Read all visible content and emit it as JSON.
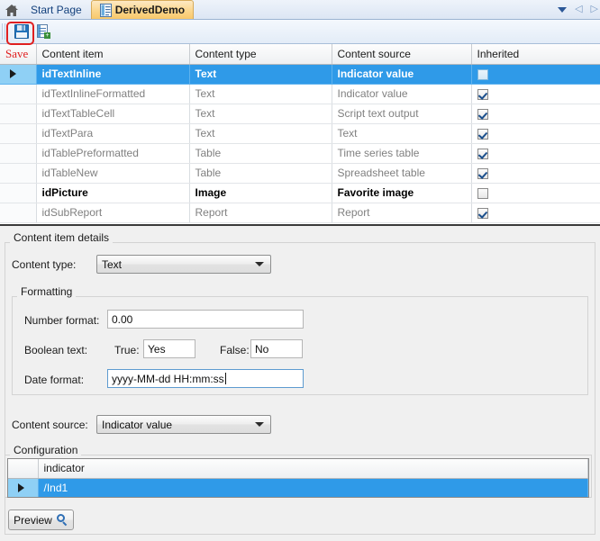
{
  "tabstrip": {
    "home_icon": "home-icon",
    "tabs": [
      {
        "label": "Start Page",
        "active": false,
        "icon": ""
      },
      {
        "label": "DerivedDemo",
        "active": true,
        "icon": "document-icon"
      }
    ],
    "dropdown_icon": "chevron-down-icon",
    "prev_icon": "◁",
    "next_icon": "▷"
  },
  "toolbar": {
    "save_icon": "save-floppy-icon",
    "new_icon": "new-document-icon"
  },
  "annotation": {
    "label": "Save",
    "color": "#e02020"
  },
  "grid": {
    "columns": [
      "",
      "Content item",
      "Content type",
      "Content source",
      "Inherited"
    ],
    "rows": [
      {
        "item": "idTextInline",
        "type": "Text",
        "source": "Indicator value",
        "inherited": false,
        "selected": true,
        "emphasis": "selected"
      },
      {
        "item": "idTextInlineFormatted",
        "type": "Text",
        "source": "Indicator value",
        "inherited": true,
        "selected": false,
        "emphasis": "gray"
      },
      {
        "item": "idTextTableCell",
        "type": "Text",
        "source": "Script text output",
        "inherited": true,
        "selected": false,
        "emphasis": "gray"
      },
      {
        "item": "idTextPara",
        "type": "Text",
        "source": "Text",
        "inherited": true,
        "selected": false,
        "emphasis": "gray"
      },
      {
        "item": "idTablePreformatted",
        "type": "Table",
        "source": "Time series table",
        "inherited": true,
        "selected": false,
        "emphasis": "gray"
      },
      {
        "item": "idTableNew",
        "type": "Table",
        "source": "Spreadsheet table",
        "inherited": true,
        "selected": false,
        "emphasis": "gray"
      },
      {
        "item": "idPicture",
        "type": "Image",
        "source": "Favorite image",
        "inherited": false,
        "selected": false,
        "emphasis": "black"
      },
      {
        "item": "idSubReport",
        "type": "Report",
        "source": "Report",
        "inherited": true,
        "selected": false,
        "emphasis": "gray"
      }
    ]
  },
  "details": {
    "group_title": "Content item details",
    "content_type": {
      "label": "Content type:",
      "value": "Text"
    },
    "formatting": {
      "group_title": "Formatting",
      "number_format": {
        "label": "Number format:",
        "value": "0.00"
      },
      "boolean_text": {
        "label": "Boolean text:",
        "true_label": "True:",
        "true_value": "Yes",
        "false_label": "False:",
        "false_value": "No"
      },
      "date_format": {
        "label": "Date format:",
        "value": "yyyy-MM-dd HH:mm:ss",
        "focused": true
      }
    },
    "content_source": {
      "label": "Content source:",
      "value": "Indicator value"
    },
    "configuration": {
      "group_title": "Configuration",
      "columns": [
        "",
        "indicator"
      ],
      "rows": [
        {
          "value": "/Ind1",
          "selected": true
        }
      ]
    },
    "preview_button": {
      "label": "Preview",
      "icon": "magnifier-icon"
    }
  }
}
